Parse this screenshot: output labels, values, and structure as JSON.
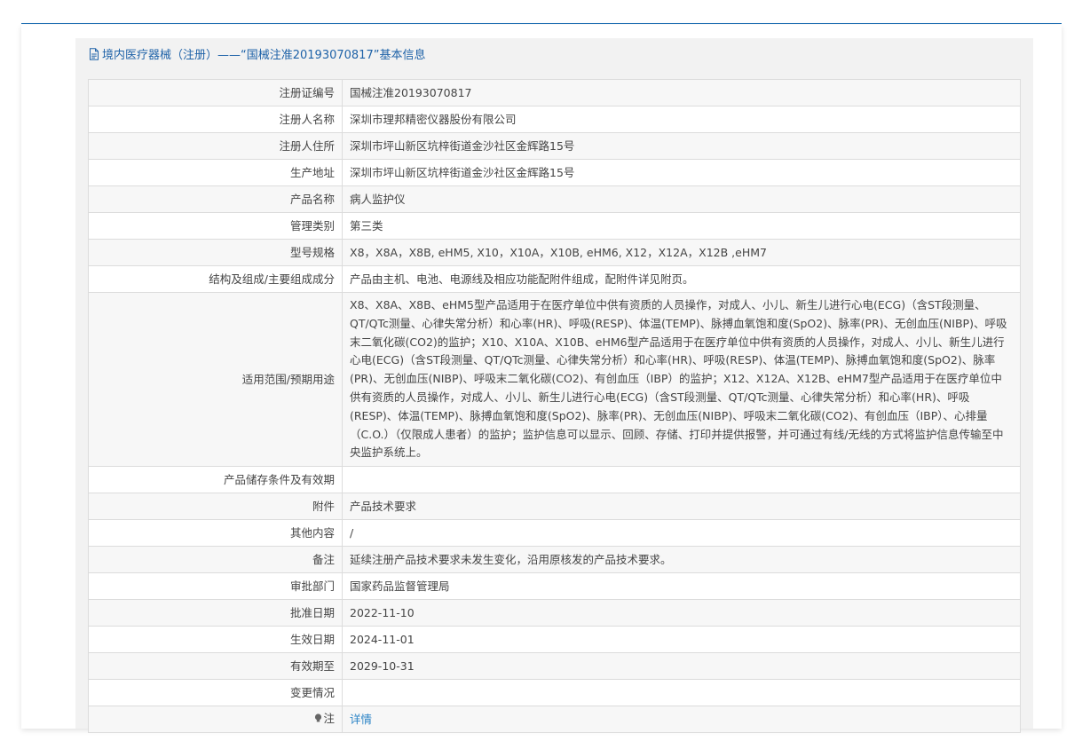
{
  "header": {
    "title": "境内医疗器械（注册）——“国械注准20193070817”基本信息"
  },
  "rows": [
    {
      "label": "注册证编号",
      "value": "国械注准20193070817"
    },
    {
      "label": "注册人名称",
      "value": "深圳市理邦精密仪器股份有限公司"
    },
    {
      "label": "注册人住所",
      "value": "深圳市坪山新区坑梓街道金沙社区金辉路15号"
    },
    {
      "label": "生产地址",
      "value": "深圳市坪山新区坑梓街道金沙社区金辉路15号"
    },
    {
      "label": "产品名称",
      "value": "病人监护仪"
    },
    {
      "label": "管理类别",
      "value": "第三类"
    },
    {
      "label": "型号规格",
      "value": "X8，X8A，X8B, eHM5, X10，X10A，X10B, eHM6, X12，X12A，X12B ,eHM7"
    },
    {
      "label": "结构及组成/主要组成成分",
      "value": "产品由主机、电池、电源线及相应功能配附件组成，配附件详见附页。"
    },
    {
      "label": "适用范围/预期用途",
      "value": "X8、X8A、X8B、eHM5型产品适用于在医疗单位中供有资质的人员操作，对成人、小儿、新生儿进行心电(ECG)（含ST段测量、QT/QTc测量、心律失常分析）和心率(HR)、呼吸(RESP)、体温(TEMP)、脉搏血氧饱和度(SpO2)、脉率(PR)、无创血压(NIBP)、呼吸末二氧化碳(CO2)的监护；X10、X10A、X10B、eHM6型产品适用于在医疗单位中供有资质的人员操作，对成人、小儿、新生儿进行心电(ECG)（含ST段测量、QT/QTc测量、心律失常分析）和心率(HR)、呼吸(RESP)、体温(TEMP)、脉搏血氧饱和度(SpO2)、脉率(PR)、无创血压(NIBP)、呼吸末二氧化碳(CO2)、有创血压（IBP）的监护；X12、X12A、X12B、eHM7型产品适用于在医疗单位中供有资质的人员操作，对成人、小儿、新生儿进行心电(ECG)（含ST段测量、QT/QTc测量、心律失常分析）和心率(HR)、呼吸(RESP)、体温(TEMP)、脉搏血氧饱和度(SpO2)、脉率(PR)、无创血压(NIBP)、呼吸末二氧化碳(CO2)、有创血压（IBP）、心排量（C.O.）（仅限成人患者）的监护；监护信息可以显示、回顾、存储、打印并提供报警，并可通过有线/无线的方式将监护信息传输至中央监护系统上。"
    },
    {
      "label": "产品储存条件及有效期",
      "value": ""
    },
    {
      "label": "附件",
      "value": "产品技术要求"
    },
    {
      "label": "其他内容",
      "value": "/"
    },
    {
      "label": "备注",
      "value": "延续注册产品技术要求未发生变化，沿用原核发的产品技术要求。"
    },
    {
      "label": "审批部门",
      "value": "国家药品监督管理局"
    },
    {
      "label": "批准日期",
      "value": "2022-11-10"
    },
    {
      "label": "生效日期",
      "value": "2024-11-01"
    },
    {
      "label": "有效期至",
      "value": "2029-10-31"
    },
    {
      "label": "变更情况",
      "value": ""
    }
  ],
  "note": {
    "label": "注",
    "link_text": "详情",
    "icon": "lightbulb-icon"
  },
  "colors": {
    "accent": "#1e62a8",
    "link": "#2a83c6",
    "border": "#dcdcdc"
  }
}
